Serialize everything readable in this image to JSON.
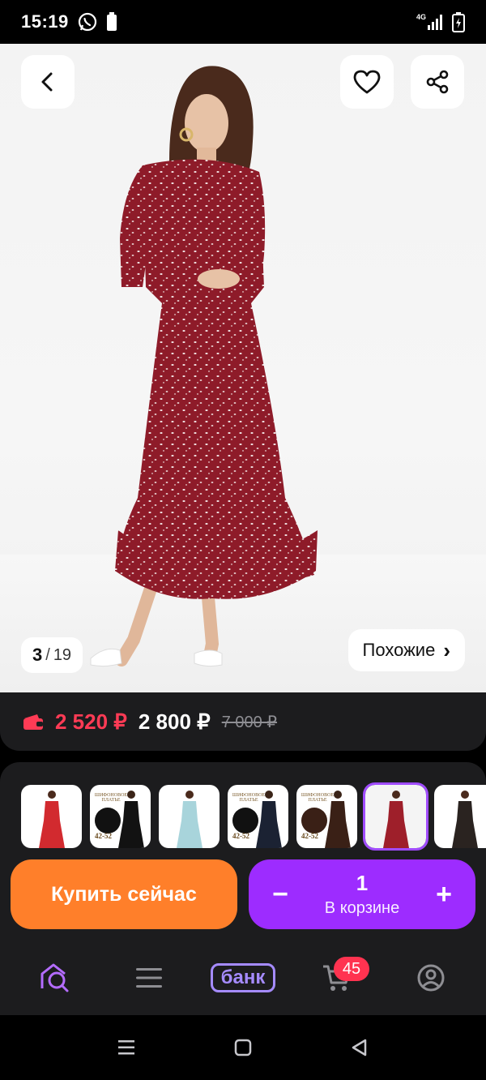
{
  "status_bar": {
    "time": "15:19",
    "network": "4G",
    "icons": [
      "whatsapp-icon",
      "battery-saver-icon",
      "signal-icon",
      "battery-charging-icon"
    ]
  },
  "gallery": {
    "current_index": "3",
    "separator": "/",
    "total": "19",
    "similar_label": "Похожие",
    "similar_chevron": "›"
  },
  "price": {
    "wallet_price": "2 520 ₽",
    "current_price": "2 800 ₽",
    "old_price": "7 000 ₽"
  },
  "variants": {
    "badge_text": "ШИФОНОВОЕ ПЛАТЬЕ",
    "size_text": "42-52",
    "colors": [
      "#d22a2f",
      "#121212",
      "#a8d4db",
      "#1b2233",
      "#3a2016",
      "#9e1f2a",
      "#2a2320"
    ],
    "selected_index": 5
  },
  "actions": {
    "buy_now": "Купить сейчас",
    "cart_qty": "1",
    "cart_label": "В корзине",
    "minus": "−",
    "plus": "+"
  },
  "tabbar": {
    "bank_label": "банк",
    "cart_badge": "45",
    "accent": "#a58bff"
  },
  "colors": {
    "buy_button": "#ff7f2a",
    "cart_button": "#9d2cff",
    "wallet_price": "#ff3b55",
    "dress": "#8e1b29"
  }
}
